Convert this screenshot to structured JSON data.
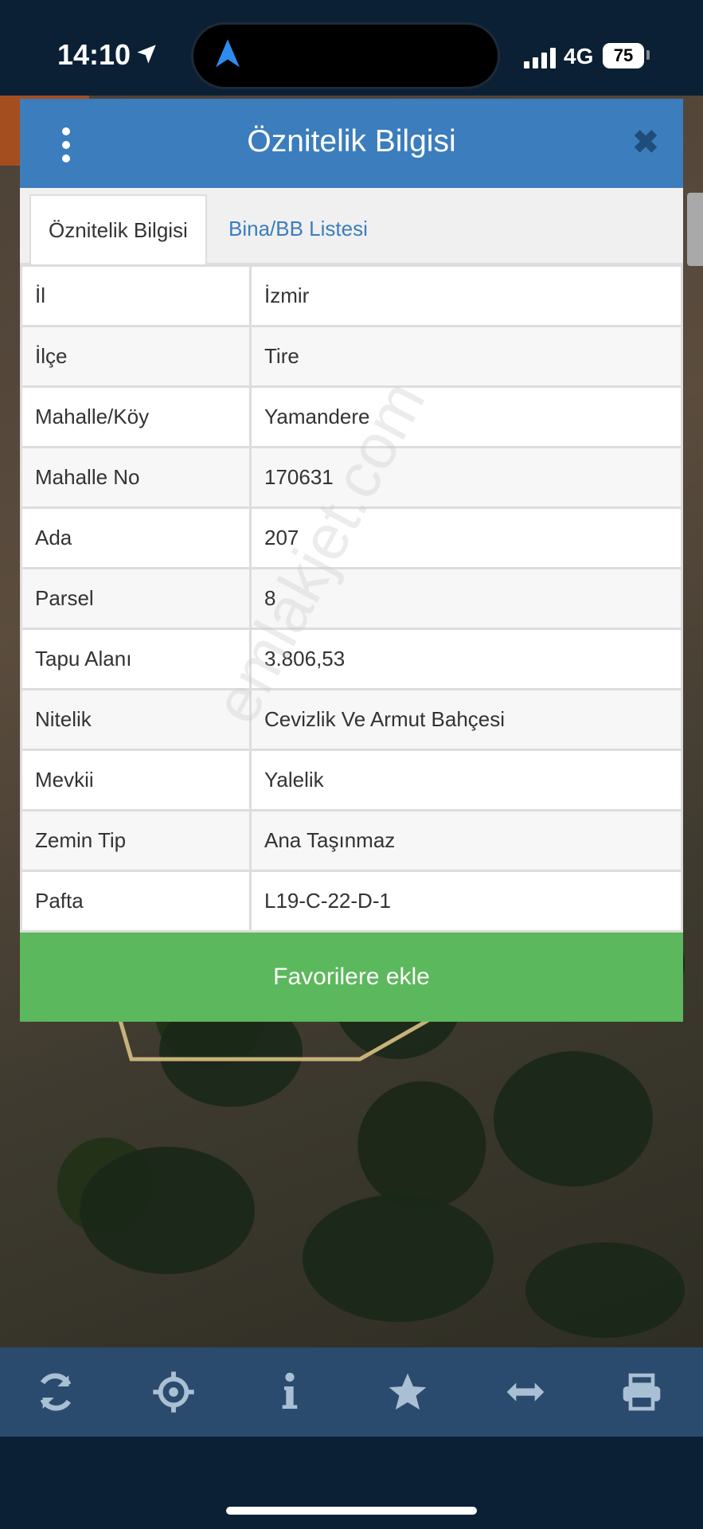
{
  "status": {
    "time": "14:10",
    "network": "4G",
    "battery": "75"
  },
  "modal": {
    "title": "Öznitelik Bilgisi",
    "close_glyph": "✖",
    "tabs": [
      {
        "label": "Öznitelik Bilgisi",
        "active": true
      },
      {
        "label": "Bina/BB Listesi",
        "active": false
      }
    ],
    "rows": [
      {
        "key": "İl",
        "value": "İzmir"
      },
      {
        "key": "İlçe",
        "value": "Tire"
      },
      {
        "key": "Mahalle/Köy",
        "value": "Yamandere"
      },
      {
        "key": "Mahalle No",
        "value": "170631"
      },
      {
        "key": "Ada",
        "value": "207"
      },
      {
        "key": "Parsel",
        "value": "8"
      },
      {
        "key": "Tapu Alanı",
        "value": "3.806,53"
      },
      {
        "key": "Nitelik",
        "value": "Cevizlik Ve Armut Bahçesi"
      },
      {
        "key": "Mevkii",
        "value": "Yalelik"
      },
      {
        "key": "Zemin Tip",
        "value": "Ana Taşınmaz"
      },
      {
        "key": "Pafta",
        "value": "L19-C-22-D-1"
      }
    ],
    "favorite_button": "Favorilere ekle"
  },
  "watermark": "emlakjet.com",
  "toolbar": {
    "icons": [
      "refresh-icon",
      "locate-icon",
      "info-icon",
      "star-icon",
      "measure-icon",
      "print-icon"
    ]
  },
  "colors": {
    "header": "#3b7dbd",
    "favorite": "#5cb85c",
    "toolbar": "#2b4b6e"
  }
}
